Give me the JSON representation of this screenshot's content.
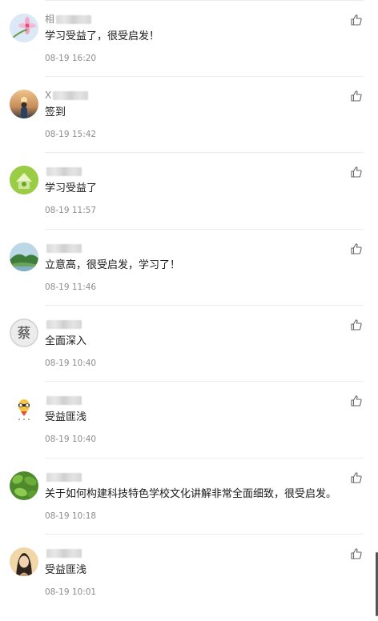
{
  "comments": [
    {
      "initial": "相",
      "text": "学习受益了，很受启发！",
      "time": "08-19 16:20",
      "avatar": "flower-avatar"
    },
    {
      "initial": "X",
      "text": "签到",
      "time": "08-19 15:42",
      "avatar": "sunset-person-avatar"
    },
    {
      "initial": "",
      "text": "学习受益了",
      "time": "08-19 11:57",
      "avatar": "green-house-avatar"
    },
    {
      "initial": "",
      "text": "立意高，很受启发，学习了！",
      "time": "08-19 11:46",
      "avatar": "landscape-avatar"
    },
    {
      "initial": "",
      "text": "全面深入",
      "time": "08-19 10:40",
      "avatar": "cai-character-avatar"
    },
    {
      "initial": "",
      "text": "受益匪浅",
      "time": "08-19 10:40",
      "avatar": "cartoon-avatar"
    },
    {
      "initial": "",
      "text": "关于如何构建科技特色学校文化讲解非常全面细致，很受启发。",
      "time": "08-19 10:18",
      "avatar": "leaves-avatar"
    },
    {
      "initial": "",
      "text": "受益匪浅",
      "time": "08-19 10:01",
      "avatar": "portrait-avatar"
    }
  ],
  "icons": {
    "like": "thumbs-up-icon"
  },
  "avatar_badge_text": "蔡"
}
